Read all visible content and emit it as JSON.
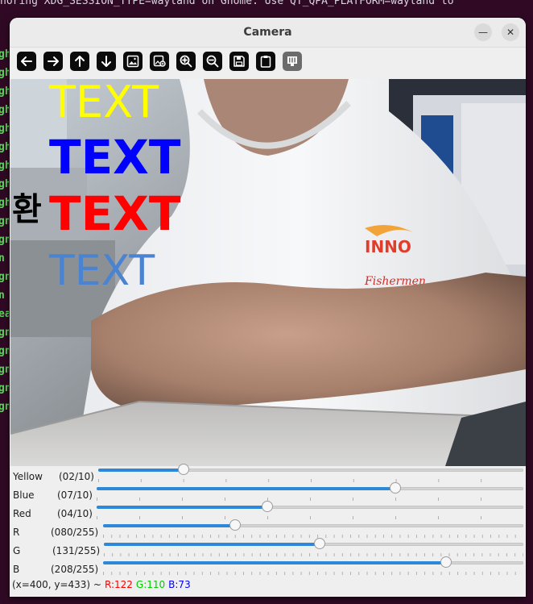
{
  "terminal": {
    "top_line": "noring XDG_SESSION_TYPE=wayland on Gnome. Use QT_QPA_PLATFORM=wayland to",
    "left_fragments": [
      "gh",
      "gh",
      "gh",
      "gh",
      "gh",
      "gh",
      "gh",
      "gh",
      "gh",
      "gn",
      "gn",
      "n",
      "gn",
      "n",
      "ea",
      "gn",
      "gn",
      "gn",
      "gn",
      "gn"
    ]
  },
  "window": {
    "title": "Camera",
    "minimize_symbol": "—",
    "close_symbol": "✕"
  },
  "toolbar": {
    "buttons": [
      "arrow-left",
      "arrow-right",
      "arrow-up",
      "arrow-down",
      "image",
      "image-edit",
      "zoom-in",
      "zoom-out",
      "save",
      "clipboard",
      "properties"
    ]
  },
  "overlay": {
    "yellow_text": "TEXT",
    "blue_text": "TEXT",
    "red_text": "TEXT",
    "korean_char": "환",
    "custom_text": "TEXT",
    "colors": {
      "yellow": "#ffff00",
      "blue": "#0000ff",
      "red": "#ff0000",
      "custom": "#4a83d0"
    }
  },
  "trackbars": [
    {
      "name": "Yellow",
      "value": "(02/10)",
      "fraction": 0.2
    },
    {
      "name": "Blue",
      "value": "(07/10)",
      "fraction": 0.7
    },
    {
      "name": "Red",
      "value": "(04/10)",
      "fraction": 0.4
    },
    {
      "name": "R",
      "value": "(080/255)",
      "fraction": 0.314
    },
    {
      "name": "G",
      "value": "(131/255)",
      "fraction": 0.514
    },
    {
      "name": "B",
      "value": "(208/255)",
      "fraction": 0.816
    }
  ],
  "status": {
    "coords": "(x=400, y=433) ~",
    "r": "R:122",
    "g": "G:110",
    "b": "B:73",
    "r_color": "#ff0000",
    "g_color": "#00cc00",
    "b_color": "#0000ff"
  }
}
